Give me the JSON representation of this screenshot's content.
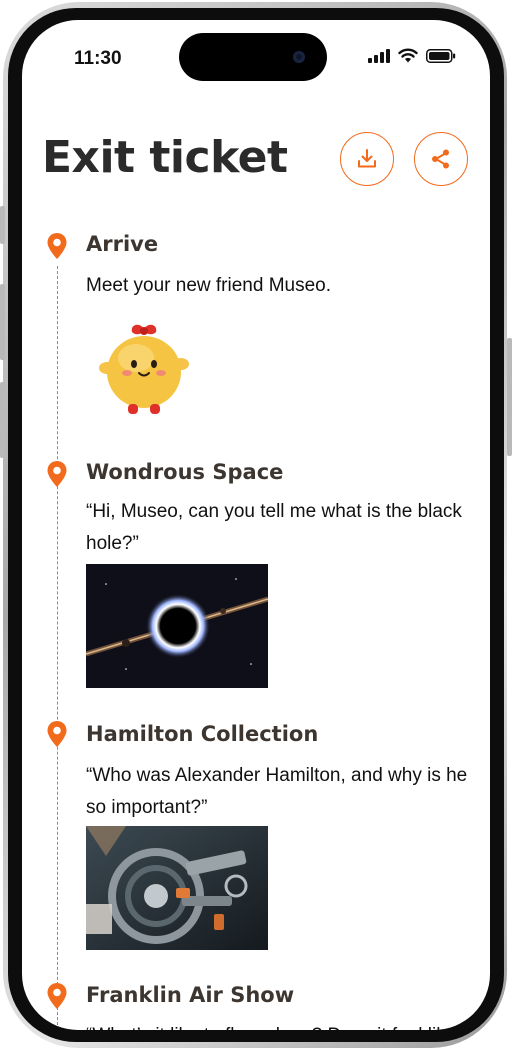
{
  "status_bar": {
    "time": "11:30"
  },
  "header": {
    "title": "Exit ticket"
  },
  "actions": {
    "download_icon": "download-icon",
    "share_icon": "share-icon",
    "accent_color": "#f26a1b"
  },
  "timeline": {
    "items": [
      {
        "title": "Arrive",
        "text": "Meet your new friend Museo."
      },
      {
        "title": "Wondrous Space",
        "text": "“Hi, Museo, can you tell me what is the black hole?”"
      },
      {
        "title": "Hamilton Collection",
        "text": "“Who was Alexander Hamilton, and why is he so important?”"
      },
      {
        "title": "Franklin Air Show",
        "text": "“What’s it like to fly a plane? Does it feel like"
      }
    ]
  }
}
